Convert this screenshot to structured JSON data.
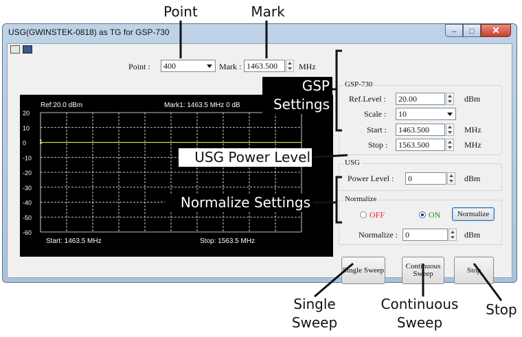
{
  "callouts": {
    "point": "Point",
    "mark": "Mark",
    "gsp_settings_line1": "GSP",
    "gsp_settings_line2": "Settings",
    "usg_power_level": "USG Power Level",
    "normalize_settings": "Normalize Settings",
    "single_sweep_line1": "Single",
    "single_sweep_line2": "Sweep",
    "continuous_sweep_line1": "Continuous",
    "continuous_sweep_line2": "Sweep",
    "stop": "Stop"
  },
  "window": {
    "title": "USG(GWINSTEK-0818) as TG for GSP-730",
    "minimize": "–",
    "maximize": "□",
    "close": "✕"
  },
  "toolbar": {
    "icons": [
      "print-icon",
      "save-icon"
    ]
  },
  "top_controls": {
    "point_label": "Point :",
    "point_value": "400",
    "mark_label": "Mark :",
    "mark_value": "1463.500",
    "mark_unit": "MHz"
  },
  "plot": {
    "ref_text": "Ref:20.0 dBm",
    "mark_text": "Mark1: 1463.5 MHz  0 dB",
    "start_text": "Start: 1463.5 MHz",
    "stop_text": "Stop: 1563.5 MHz",
    "marker_symbol": "1",
    "y_ticks": [
      "20",
      "10",
      "0",
      "-10",
      "-20",
      "-30",
      "-40",
      "-50",
      "-60"
    ],
    "grid_color": "#ffffff",
    "trace_color": "#c8e050",
    "background": "#000000"
  },
  "gsp730": {
    "title": "GSP-730",
    "ref_level_label": "Ref.Level :",
    "ref_level_value": "20.00",
    "ref_level_unit": "dBm",
    "scale_label": "Scale :",
    "scale_value": "10",
    "start_label": "Start :",
    "start_value": "1463.500",
    "start_unit": "MHz",
    "stop_label": "Stop :",
    "stop_value": "1563.500",
    "stop_unit": "MHz"
  },
  "usg": {
    "title": "USG",
    "power_label": "Power Level :",
    "power_value": "0",
    "power_unit": "dBm"
  },
  "normalize": {
    "title": "Normalize",
    "off_label": "OFF",
    "on_label": "ON",
    "selected": "ON",
    "button_label": "Normalize",
    "value_label": "Normalize :",
    "value": "0",
    "unit": "dBm",
    "off_color": "#e0281e",
    "on_color": "#1e8a1e"
  },
  "buttons": {
    "single_sweep": "Single Sweep",
    "continuous_sweep_line1": "Continuous",
    "continuous_sweep_line2": "Sweep",
    "stop": "Stop"
  }
}
